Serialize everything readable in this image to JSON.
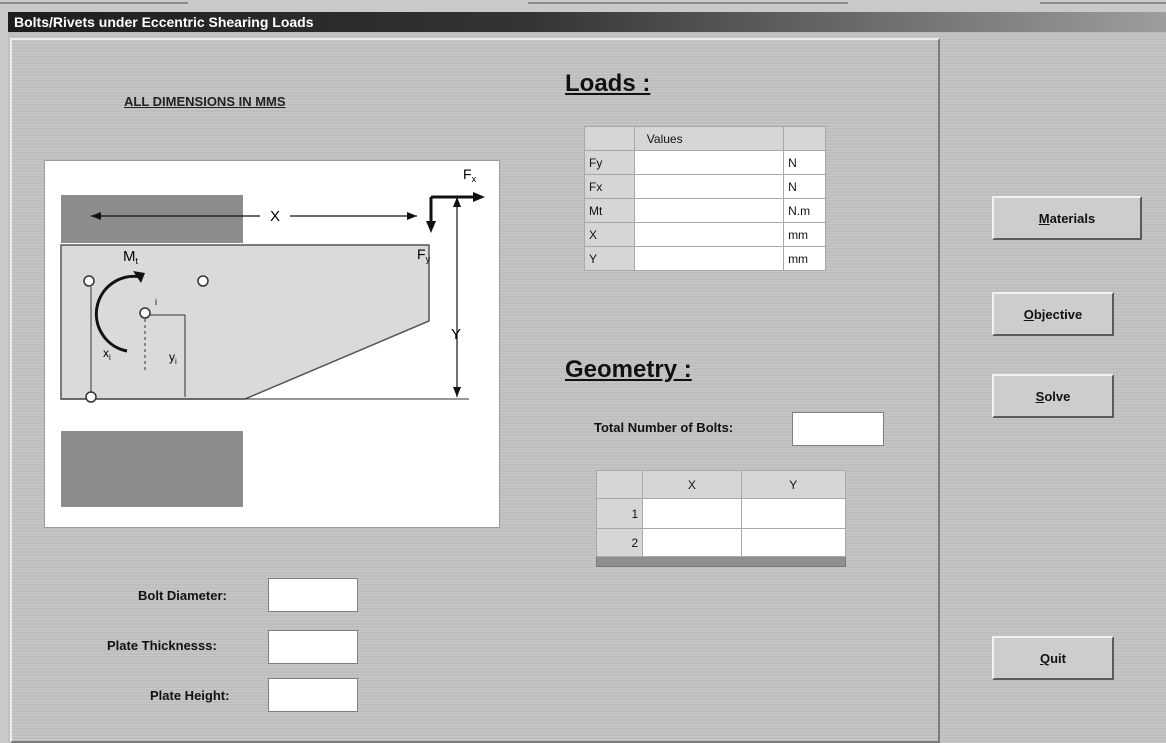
{
  "window": {
    "title": "Bolts/Rivets under Eccentric Shearing  Loads"
  },
  "note": "ALL DIMENSIONS IN MMS",
  "diagram": {
    "labels": {
      "fx": "F",
      "fx_sub": "x",
      "fy": "F",
      "fy_sub": "y",
      "x": "X",
      "y": "Y",
      "mt": "M",
      "mt_sub": "t",
      "xi": "x",
      "xi_sub": "i",
      "yi": "y",
      "yi_sub": "i",
      "i": "i"
    }
  },
  "loads": {
    "heading": "Loads :",
    "column_header": "Values",
    "rows": [
      {
        "label": "Fy",
        "value": "",
        "unit": "N"
      },
      {
        "label": "Fx",
        "value": "",
        "unit": "N"
      },
      {
        "label": "Mt",
        "value": "",
        "unit": "N.m"
      },
      {
        "label": "X",
        "value": "",
        "unit": "mm"
      },
      {
        "label": "Y",
        "value": "",
        "unit": "mm"
      }
    ]
  },
  "geometry": {
    "heading": "Geometry :",
    "total_bolts_label": "Total Number of Bolts:",
    "total_bolts_value": "",
    "columns": [
      "X",
      "Y"
    ],
    "rows": [
      {
        "index": "1",
        "x": "",
        "y": ""
      },
      {
        "index": "2",
        "x": "",
        "y": ""
      }
    ]
  },
  "fields": {
    "bolt_diameter_label": "Bolt Diameter:",
    "plate_thickness_label": "Plate Thicknesss:",
    "plate_height_label": "Plate Height:"
  },
  "buttons": {
    "materials": {
      "key": "M",
      "rest": "aterials"
    },
    "objective": {
      "key": "O",
      "rest": "bjective"
    },
    "solve": {
      "key": "S",
      "rest": "olve"
    },
    "quit": {
      "key": "Q",
      "rest": "uit"
    }
  }
}
